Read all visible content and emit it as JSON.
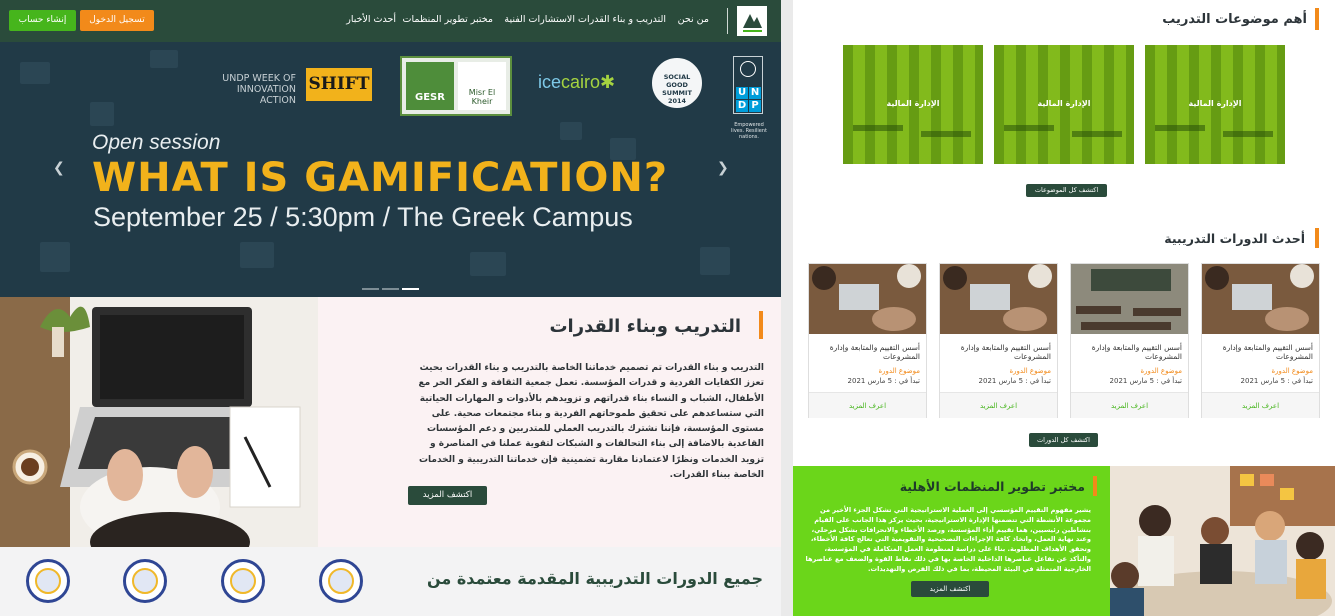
{
  "nav": {
    "links": [
      "من نحن",
      "التدريب و بناء القدرات",
      "الاستشارات الفنية",
      "مختبر تطوير المنظمات",
      "أحدث الأخبار"
    ],
    "login_label": "تسجيل الدخول",
    "register_label": "إنشاء حساب"
  },
  "hero": {
    "sponsor_line1": "UNDP WEEK OF",
    "sponsor_line2": "INNOVATION ACTION",
    "shift_logo": "SHIFT",
    "gesr_logo": "GESR",
    "misr_logo": "Misr El Kheir",
    "icecairo_logo_a": "ice",
    "icecairo_logo_b": "cairo",
    "sgs_logo": "SOCIAL GOOD SUMMIT 2014",
    "undp_letters": [
      "U",
      "N",
      "D",
      "P"
    ],
    "undp_tagline": "Empowered lives. Resilient nations.",
    "kicker": "Open session",
    "headline": "WHAT IS GAMIFICATION?",
    "subline": "September 25 / 5:30pm / The Greek Campus",
    "prev_icon": "chevron-left-icon",
    "next_icon": "chevron-right-icon",
    "slides_count": 3,
    "active_slide": 3
  },
  "training": {
    "title": "التدريب وبناء القدرات",
    "paragraph": "التدريب و بناء القدرات تم تصميم خدماتنا الخاصة بالتدريب و بناء القدرات بحيث تعزز الكفايات الفردية و قدرات المؤسسة. تعمل جمعية الثقافة و الفكر الحر مع الأطفال، الشباب و النساء بناء قدراتهم و تزويدهم بالأدوات و المهارات الحياتية التي ستساعدهم على تحقيق طموحاتهم الفردية و بناء مجتمعات صحية. على مستوى المؤسسة، فإننا نشترك بالتدريب العملي للمتدربين و دعم المؤسسات القاعدية بالاضافة إلى بناء التحالفات و الشبكات لتقوية عملنا في المناصرة و تزويد الخدمات ونظرًا لاعتمادنا مقاربة تضمينية فإن خدماتنا التدريبية و الخدمات الخاصة ببناء القدرات.",
    "more_label": "اكتشف المزيد"
  },
  "advanced": {
    "title": "جميع الدورات التدريبية المقدمة معتمدة من",
    "badges_count": 4
  },
  "topics": {
    "title": "أهم موضوعات التدريب",
    "items": [
      "الإدارة المالية",
      "الإدارة المالية",
      "الإدارة المالية"
    ],
    "all_label": "اكتشف كل الموضوعات"
  },
  "courses": {
    "title": "أحدث الدورات التدريبية",
    "items": [
      {
        "title": "أسس التقييم والمتابعة وإدارة المشروعات",
        "topic": "موضوع الدورة",
        "date": "تبدأ في : 5 مارس 2021",
        "more": "اعرف المزيد"
      },
      {
        "title": "أسس التقييم والمتابعة وإدارة المشروعات",
        "topic": "موضوع الدورة",
        "date": "تبدأ في : 5 مارس 2021",
        "more": "اعرف المزيد"
      },
      {
        "title": "أسس التقييم والمتابعة وإدارة المشروعات",
        "topic": "موضوع الدورة",
        "date": "تبدأ في : 5 مارس 2021",
        "more": "اعرف المزيد"
      },
      {
        "title": "أسس التقييم والمتابعة وإدارة المشروعات",
        "topic": "موضوع الدورة",
        "date": "تبدأ في : 5 مارس 2021",
        "more": "اعرف المزيد"
      }
    ],
    "all_label": "اكتشف كل الدورات"
  },
  "lab": {
    "title": "مختبر تطوير المنظمات الأهلية",
    "paragraph": "يشير مفهوم التقييم المؤسسي إلى العملية الاستراتيجية التي تشكل الجزء الأخير من مجموعة الأنشطة التي تتضمنها الإدارة الاستراتيجية، بحيث يركز هذا الجانب على القيام بنشاطين رئيسيين، هما تقييم أداء المؤسسة، ورصد الأخطاء والانحرافات بشكل مرحلي، وعند نهاية العمل، واتخاذ كافة الإجراءات التصحيحية والتقويمية التي تعالج كافة الأخطاء، وتحقق الأهداف المطلوبة. بناءً على دراسة لمنظومة العمل المتكاملة في المؤسسة، والتأكد عن تفاعل عناصرها الداخلية الخاصة بها في ذلك نقاط القوة والضعف مع عناصرها الخارجية المتمثلة في البيئة المحيطة، بما في ذلك الفرص والتهديدات.",
    "more_label": "اكتشف المزيد"
  },
  "colors": {
    "nav": "#2a4b3b",
    "accent_orange": "#f28a1a",
    "accent_green": "#46b51c",
    "lab_green": "#6bd61a",
    "hero_bg": "#213a47",
    "headline_yellow": "#f2b21b"
  }
}
